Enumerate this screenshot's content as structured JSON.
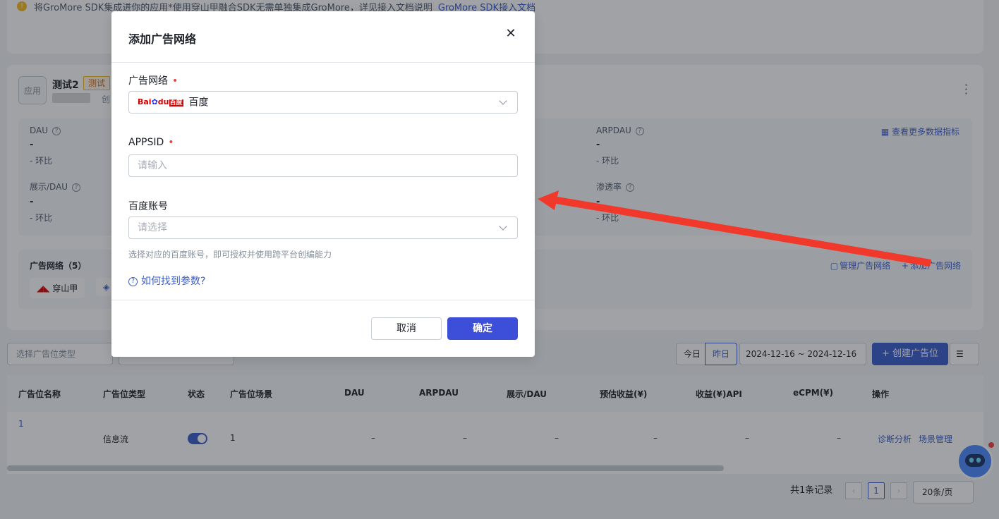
{
  "background": {
    "notice": {
      "text": "将GroMore SDK集成进你的应用*使用穿山甲融合SDK无需单独集成GroMore，详见接入文档说明",
      "link": "GroMore SDK接入文档"
    },
    "app": {
      "badge": "应用",
      "name": "测试2",
      "tag": "测试",
      "meta": "创"
    },
    "metrics": [
      {
        "label": "DAU",
        "value": "-",
        "compare": "-  环比"
      },
      {
        "label": "展示/DAU",
        "value": "-",
        "compare": "-  环比"
      },
      {
        "label": "ARPDAU",
        "value": "-",
        "compare": "-  环比"
      },
      {
        "label": "渗透率",
        "value": "-",
        "compare": "-  环比"
      }
    ],
    "more_metrics": "查看更多数据指标",
    "network": {
      "title": "广告网络（5）",
      "chip1": "穿山甲",
      "manage": "管理广告网络",
      "add": "添加广告网络"
    },
    "toolbar": {
      "type_select": "选择广告位类型",
      "today": "今日",
      "yesterday": "昨日",
      "date_range": "2024-12-16 ~ 2024-12-16",
      "create": "+ 创建广告位"
    },
    "table": {
      "headers": [
        "广告位名称",
        "广告位类型",
        "状态",
        "广告位场景",
        "DAU",
        "ARPDAU",
        "展示/DAU",
        "预估收益(¥)",
        "收益(¥)API",
        "eCPM(¥)",
        "操作"
      ],
      "row": {
        "id": "1",
        "type": "信息流",
        "scene": "1",
        "dash": "–",
        "diag": "诊断分析",
        "scene_manage": "场景管理"
      }
    },
    "pagination": {
      "total": "共1条记录",
      "page": "1",
      "page_size": "20条/页"
    }
  },
  "modal": {
    "title": "添加广告网络",
    "network_label": "广告网络",
    "network_value": "百度",
    "logo_text": {
      "bai": "Bai",
      "du": "du",
      "cn": "百度"
    },
    "appsid_label": "APPSID",
    "appsid_placeholder": "请输入",
    "account_label": "百度账号",
    "account_placeholder": "请选择",
    "account_help": "选择对应的百度账号，即可授权并使用跨平台创编能力",
    "find_params": "如何找到参数?",
    "cancel": "取消",
    "confirm": "确定"
  }
}
